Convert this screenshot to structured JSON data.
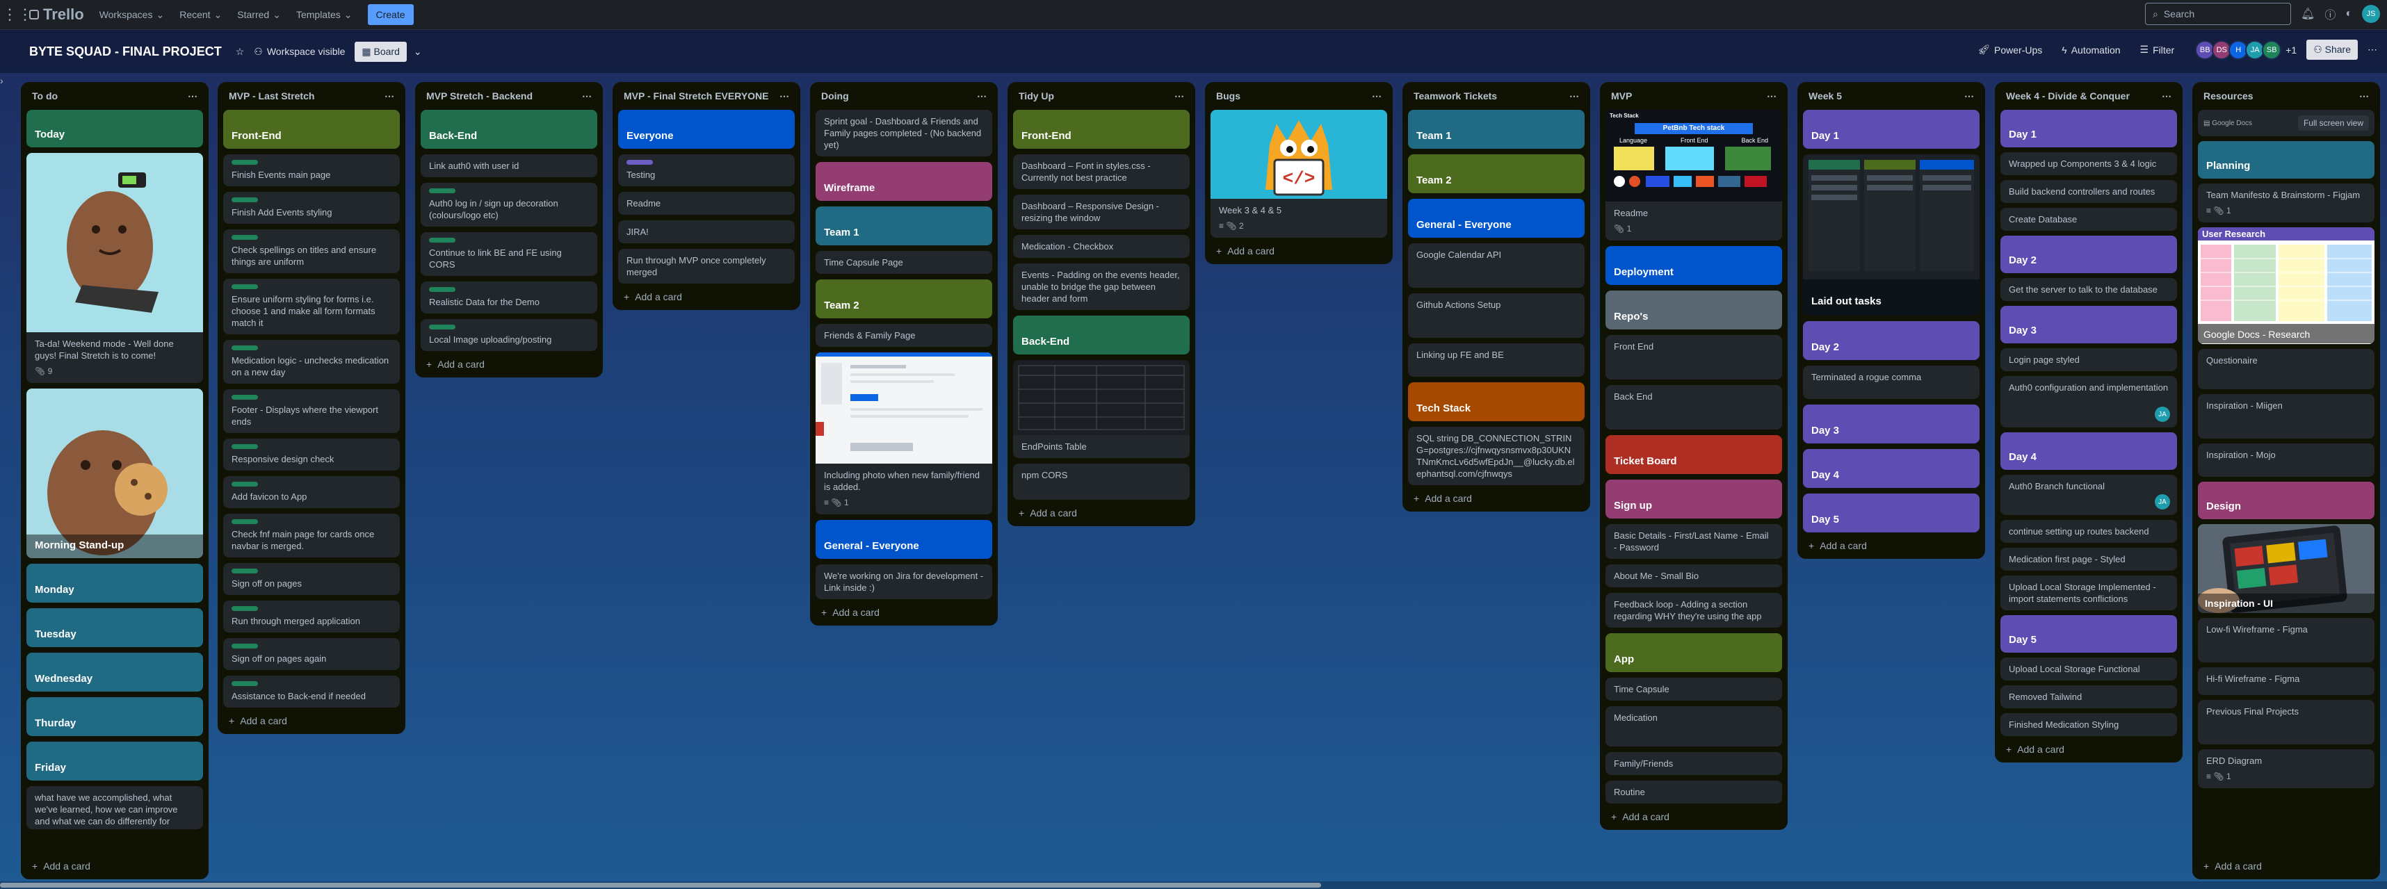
{
  "app": {
    "name": "Trello",
    "workspaces": "Workspaces",
    "recent": "Recent",
    "starred": "Starred",
    "templates": "Templates",
    "create": "Create",
    "search_placeholder": "Search",
    "user_initials": "JS"
  },
  "board": {
    "title": "BYTE SQUAD - FINAL PROJECT",
    "visibility": "Workspace visible",
    "view": "Board",
    "powerups": "Power-Ups",
    "automation": "Automation",
    "filter": "Filter",
    "members": [
      {
        "initials": "BB",
        "color": "#5e4db2"
      },
      {
        "initials": "DS",
        "color": "#943d73"
      },
      {
        "initials": "H",
        "color": "#0c66e4"
      },
      {
        "initials": "JA",
        "color": "#1f9dad"
      },
      {
        "initials": "SB",
        "color": "#1f845a"
      }
    ],
    "extra_members": "+1",
    "share": "Share",
    "add_card": "Add a card"
  },
  "colors": {
    "green": "#216e4e",
    "lime": "#4c6b1f",
    "teal": "#206a83",
    "blue": "#0055cc",
    "purple": "#5e4db2",
    "magenta": "#943d73",
    "orange": "#a54800",
    "red": "#ae2e24",
    "gray": "#596773",
    "card": "#22272b",
    "list": "#101204"
  },
  "lists": {
    "todo": {
      "title": "To do",
      "covers": {
        "today": "Today",
        "standup": "Morning Stand-up",
        "monday": "Monday",
        "tuesday": "Tuesday",
        "wednesday": "Wednesday",
        "thursday": "Thurday",
        "friday": "Friday"
      },
      "weekend": "Ta-da! Weekend mode - Well done guys! Final Stretch is to come!",
      "weekend_attach": "9",
      "friday_text": "what have we accomplished, what we've learned, how we can improve and what we can do differently for"
    },
    "mvp_last": {
      "title": "MVP - Last Stretch",
      "cover": "Front-End",
      "cards": [
        "Finish Events main page",
        "Finish Add Events styling",
        "Check spellings on titles and ensure things are uniform",
        "Ensure uniform styling for forms i.e. choose 1 and make all form formats match it",
        "Medication logic - unchecks medication on a new day",
        "Footer - Displays where the viewport ends",
        "Responsive design check",
        "Add favicon to App",
        "Check fnf main page for cards once navbar is merged.",
        "Sign off on pages",
        "Run through merged application",
        "Sign off on pages again",
        "Assistance to Back-end if needed"
      ]
    },
    "mvp_backend": {
      "title": "MVP Stretch - Backend",
      "cover": "Back-End",
      "cards": [
        "Link auth0 with user id",
        "Auth0 log in / sign up decoration (colours/logo etc)",
        "Continue to link BE and FE using CORS",
        "Realistic Data for the Demo",
        "Local Image uploading/posting"
      ]
    },
    "mvp_final": {
      "title": "MVP - Final Stretch EVERYONE",
      "cover": "Everyone",
      "cards": [
        "Testing",
        "Readme",
        "JIRA!",
        "Run through MVP once completely merged"
      ]
    },
    "doing": {
      "title": "Doing",
      "sprint": "Sprint goal - Dashboard & Friends and Family pages completed - (No backend yet)",
      "wireframe": "Wireframe",
      "team1": "Team 1",
      "time_capsule": "Time Capsule Page",
      "team2": "Team 2",
      "fnf": "Friends & Family Page",
      "photo": "Including photo when new family/friend is added.",
      "photo_attach": "1",
      "general": "General - Everyone",
      "jira": "We're working on Jira for development - Link inside :)"
    },
    "tidy": {
      "title": "Tidy Up",
      "frontend": "Front-End",
      "c1": "Dashboard – Font in styles.css - Currently not best practice",
      "c2": "Dashboard – Responsive Design - resizing the window",
      "c3": "Medication - Checkbox",
      "c4": "Events - Padding on the events header, unable to bridge the gap between header and form",
      "backend": "Back-End",
      "endpoints": "EndPoints Table",
      "cors": "npm CORS"
    },
    "bugs": {
      "title": "Bugs",
      "card": "Week 3 & 4 & 5",
      "attach": "2"
    },
    "teamwork": {
      "title": "Teamwork Tickets",
      "team1": "Team 1",
      "team2": "Team 2",
      "general": "General - Everyone",
      "gcal": "Google Calendar API",
      "gha": "Github Actions Setup",
      "link": "Linking up FE and BE",
      "techstack": "Tech Stack",
      "sql": "SQL string DB_CONNECTION_STRING=postgres://cjfnwqysnsmvx8p30UKNTNmKmcLv6d5wfEpdJn__@lucky.db.elephantsql.com/cjfnwqys"
    },
    "mvp": {
      "title": "MVP",
      "techstack_img_title": "Tech Stack",
      "techstack_img_heading": "PetBnb Tech stack",
      "techstack_cols": [
        "Language",
        "Front End",
        "Back End"
      ],
      "readme": "Readme",
      "readme_attach": "1",
      "deployment": "Deployment",
      "repos": "Repo's",
      "frontend": "Front End",
      "backend": "Back End",
      "ticket": "Ticket Board",
      "signup": "Sign up",
      "basic": "Basic Details - First/Last Name - Email - Password",
      "about": "About Me - Small Bio",
      "feedback": "Feedback loop - Adding a section regarding WHY they're using the app",
      "app": "App",
      "timecap": "Time Capsule",
      "medication": "Medication",
      "family": "Family/Friends",
      "routine": "Routine"
    },
    "week5": {
      "title": "Week 5",
      "day1": "Day 1",
      "laid": "Laid out tasks",
      "day2": "Day 2",
      "rogue": "Terminated a rogue comma",
      "day3": "Day 3",
      "day4": "Day 4",
      "day5": "Day 5"
    },
    "week4": {
      "title": "Week 4 - Divide & Conquer",
      "day1": "Day 1",
      "c1": "Wrapped up Components 3 & 4 logic",
      "c2": "Build backend controllers and routes",
      "c3": "Create Database",
      "day2": "Day 2",
      "c4": "Get the server to talk to the database",
      "day3": "Day 3",
      "c5": "Login page styled",
      "c6": "Auth0 configuration and implementation",
      "day4": "Day 4",
      "c7": "Auth0 Branch functional",
      "c8": "continue setting up routes backend",
      "c9": "Medication first page - Styled",
      "c10": "Upload Local Storage Implemented - import statements conflictions",
      "day5": "Day 5",
      "c11": "Upload Local Storage Functional",
      "c12": "Removed Tailwind",
      "c13": "Finished Medication Styling",
      "member": "JA"
    },
    "resources": {
      "title": "Resources",
      "gdocs": "Google Docs",
      "fullscreen": "Full screen view",
      "planning": "Planning",
      "manifesto": "Team Manifesto & Brainstorm - Figjam",
      "manifesto_attach": "1",
      "user_research_img": "User Research",
      "gdocs_research": "Google Docs - Research",
      "questionaire": "Questionaire",
      "miigen": "Inspiration - Miigen",
      "mojo": "Inspiration - Mojo",
      "design": "Design",
      "inspo_ui": "Inspiration - UI",
      "lofi": "Low-fi Wireframe - Figma",
      "hifi": "Hi-fi Wireframe - Figma",
      "prev": "Previous Final Projects",
      "erd": "ERD Diagram",
      "erd_attach": "1"
    }
  }
}
